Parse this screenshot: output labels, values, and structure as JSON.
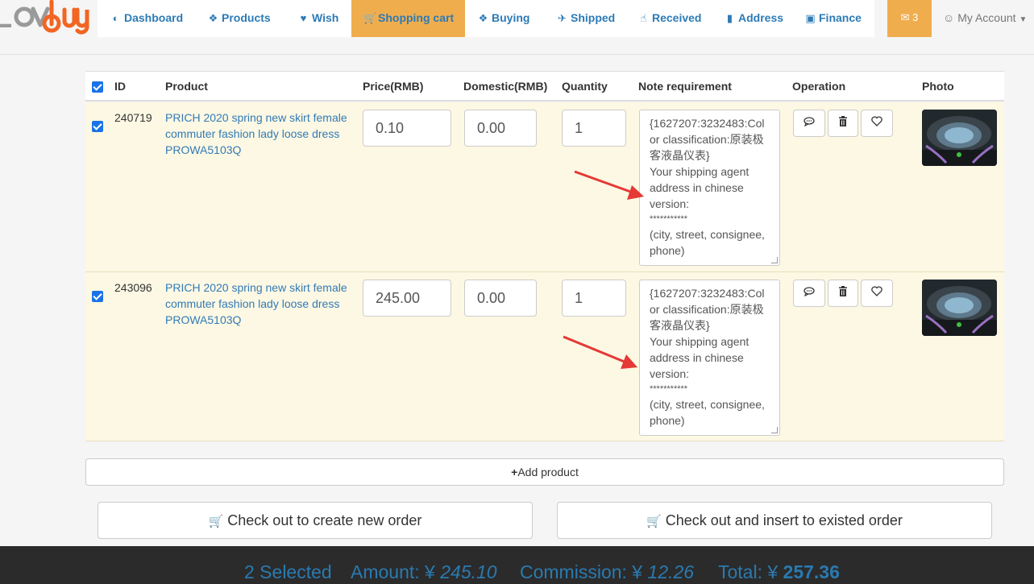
{
  "nav": {
    "logo_text": "Lovbuy",
    "items": [
      {
        "label": "Dashboard",
        "icon": "dashboard-icon"
      },
      {
        "label": "Products",
        "icon": "cubes-icon"
      },
      {
        "label": "Wish",
        "icon": "heart-icon"
      },
      {
        "label": "Shopping cart",
        "icon": "cart-icon",
        "active": true
      },
      {
        "label": "Buying",
        "icon": "cubes-icon"
      },
      {
        "label": "Shipped",
        "icon": "plane-icon"
      },
      {
        "label": "Received",
        "icon": "thumbs-up-icon"
      },
      {
        "label": "Address",
        "icon": "bookmark-icon"
      },
      {
        "label": "Finance",
        "icon": "money-icon"
      }
    ],
    "messages_count": "3",
    "account_label": "My Account"
  },
  "table": {
    "headers": [
      "ID",
      "Product",
      "Price(RMB)",
      "Domestic(RMB)",
      "Quantity",
      "Note requirement",
      "Operation",
      "Photo"
    ],
    "rows": [
      {
        "id": "240719",
        "product": "PRICH 2020 spring new skirt female commuter fashion lady loose dress PROWA5103Q",
        "price": "0.10",
        "domestic": "0.00",
        "quantity": "1",
        "note": [
          "{1627207:3232483:Col",
          "or classification:原装极",
          "客液晶仪表}",
          "Your shipping agent",
          "address in chinese",
          "version:",
          "***********",
          "(city, street, consignee,",
          "phone)"
        ]
      },
      {
        "id": "243096",
        "product": "PRICH 2020 spring new skirt female commuter fashion lady loose dress PROWA5103Q",
        "price": "245.00",
        "domestic": "0.00",
        "quantity": "1",
        "note": [
          "{1627207:3232483:Col",
          "or classification:原装极",
          "客液晶仪表}",
          "Your shipping agent",
          "address in chinese",
          "version:",
          "***********",
          "(city, street, consignee,",
          "phone)"
        ]
      }
    ]
  },
  "actions": {
    "add_product": "Add product",
    "checkout_new": "Check out to create new order",
    "checkout_existing": "Check out and insert to existed order"
  },
  "summary": {
    "selected": "2 Selected",
    "amount_label": "Amount: ¥",
    "amount": "245.10",
    "commission_label": "Commission: ¥",
    "commission": "12.26",
    "total_label": "Total: ¥",
    "total": "257.36"
  },
  "colors": {
    "accent": "#f0ad4e",
    "link": "#337ab7",
    "row_highlight": "#fcf8e3",
    "footer_bg": "#2b2b2b",
    "annotation_arrow": "#e53935"
  }
}
